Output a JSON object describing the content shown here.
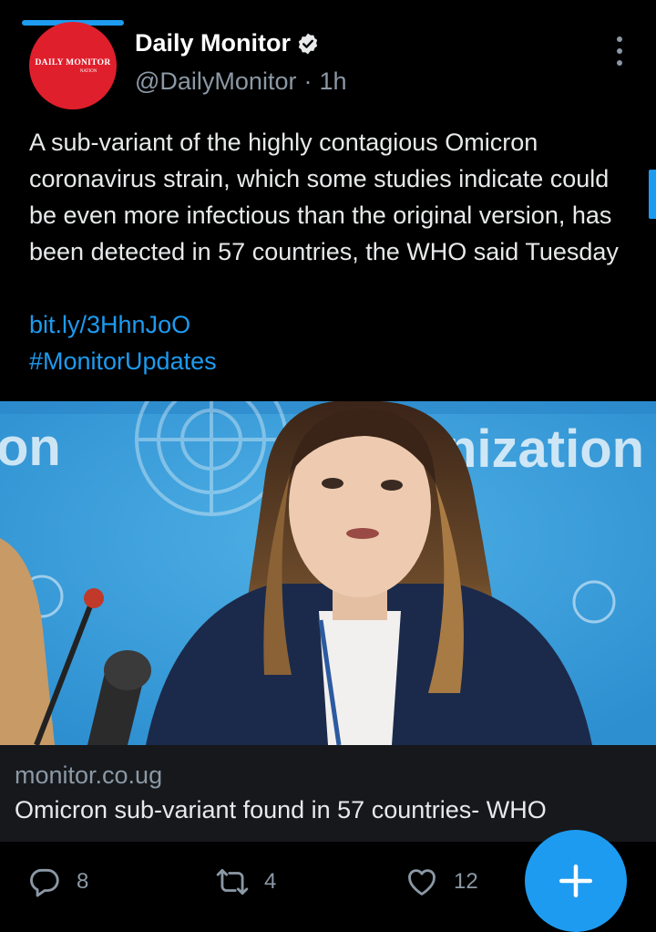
{
  "account": {
    "avatar_brand": "DAILY MONITOR",
    "avatar_sub": "NATION",
    "display_name": "Daily Monitor",
    "verified": true,
    "handle": "@DailyMonitor",
    "separator": "·",
    "time": "1h"
  },
  "tweet": {
    "text": "A sub-variant of the highly contagious Omicron coronavirus strain, which some studies indicate could be even more infectious than the original version, has been detected in 57 countries, the WHO said Tuesday",
    "link": "bit.ly/3HhnJoO",
    "hashtag": "#MonitorUpdates"
  },
  "media": {
    "backdrop_text_left": "on",
    "backdrop_text_right": "nization"
  },
  "card": {
    "domain": "monitor.co.ug",
    "title": "Omicron sub-variant found in 57 countries- WHO"
  },
  "actions": {
    "replies": "8",
    "retweets": "4",
    "likes": "12"
  },
  "icons": {
    "reply": "reply-icon",
    "retweet": "retweet-icon",
    "like": "heart-icon",
    "compose": "plus-icon",
    "more": "more-vertical-icon",
    "verified": "verified-badge-icon"
  },
  "colors": {
    "accent": "#1d9bf0",
    "background": "#000000",
    "card_background": "#16181c",
    "avatar_red": "#e01f2c",
    "muted_text": "#8b98a5"
  }
}
